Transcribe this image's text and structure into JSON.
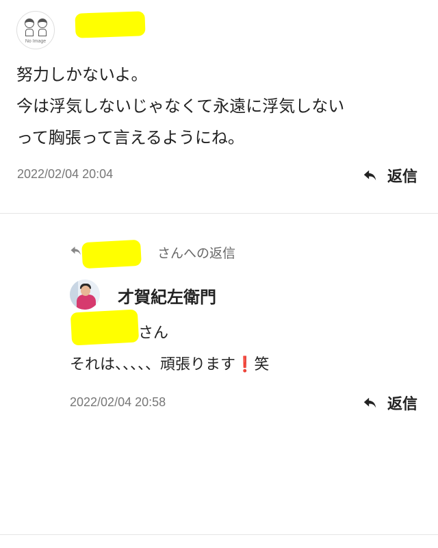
{
  "colors": {
    "redaction": "#ffff00",
    "text": "#222222",
    "muted": "#777777",
    "exclaim": "#e0202a"
  },
  "comment": {
    "avatar_text": "No Image",
    "body_lines": [
      "努力しかないよ。",
      "今は浮気しないじゃなくて永遠に浮気しない",
      "って胸張って言えるようにね。"
    ],
    "timestamp": "2022/02/04 20:04",
    "reply_label": "返信",
    "reply_icon": "reply-arrow-icon"
  },
  "reply": {
    "reply_to_suffix": "さんへの返信",
    "author_name": "才賀紀左衛門",
    "mention_suffix": "さん",
    "body_text": "それは、、、、、頑張ります",
    "exclaim": "❗",
    "body_tail": "笑",
    "timestamp": "2022/02/04 20:58",
    "reply_label": "返信",
    "reply_icon": "reply-arrow-icon"
  }
}
